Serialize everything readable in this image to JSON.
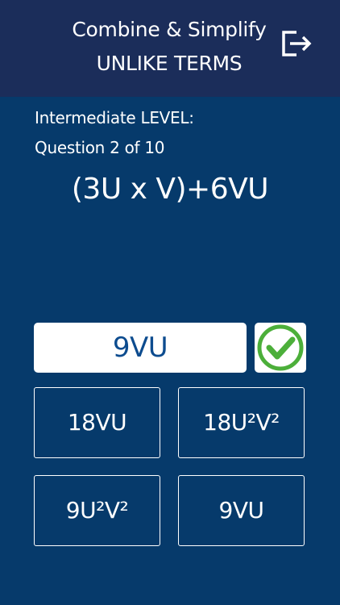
{
  "header": {
    "title_line1": "Combine & Simplify",
    "title_line2": "UNLIKE TERMS",
    "exit_icon": "exit-icon"
  },
  "quiz": {
    "level": "Intermediate LEVEL:",
    "question_number": "Question 2 of 10",
    "expression": "(3U x V)+6VU"
  },
  "answer": {
    "value": "9VU",
    "status_icon": "checkmark-icon",
    "correct_color": "#4caf3a"
  },
  "options": [
    {
      "label": "18VU"
    },
    {
      "label": "18U²V²"
    },
    {
      "label": "9U²V²"
    },
    {
      "label": "9VU"
    }
  ],
  "colors": {
    "background": "#063a6b",
    "header": "#1b2d5a",
    "answer_text": "#0d4c8f"
  }
}
